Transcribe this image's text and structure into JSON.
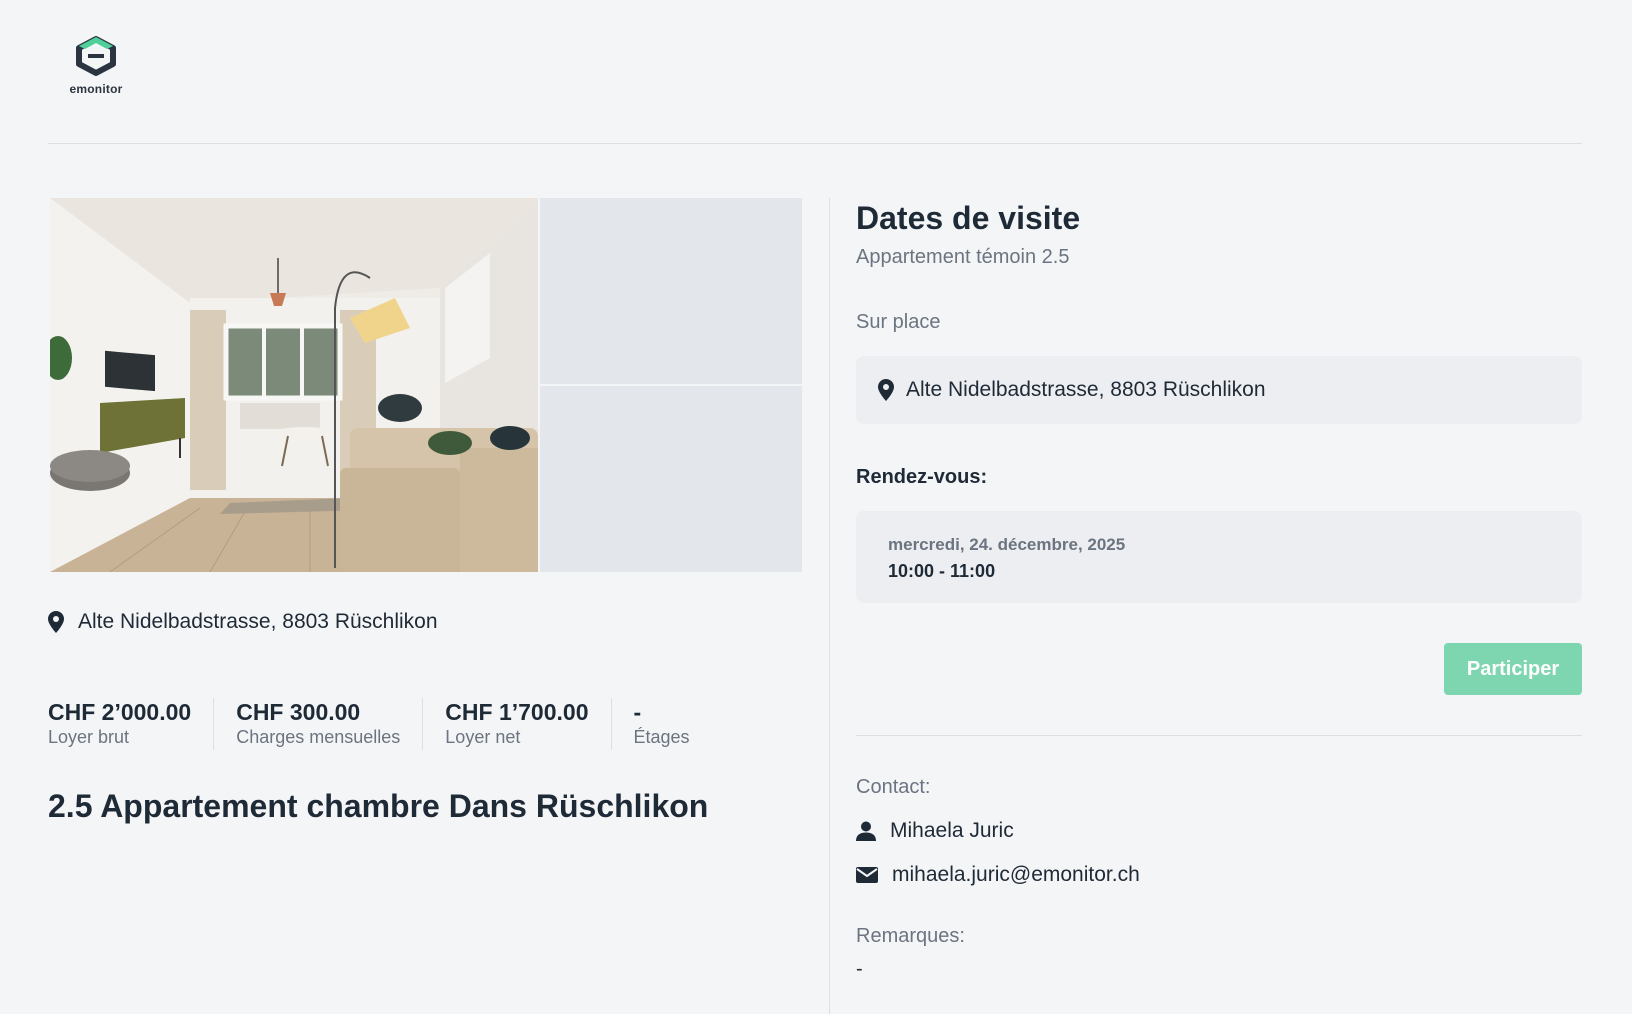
{
  "brand": {
    "name": "emonitor",
    "accent": "#7ed6b1",
    "logo_green": "#4fcf9a",
    "logo_dark": "#2b3440"
  },
  "listing": {
    "address": "Alte Nidelbadstrasse, 8803 Rüschlikon",
    "title": "2.5 Appartement chambre Dans Rüschlikon",
    "stats": [
      {
        "value": "CHF 2’000.00",
        "label": "Loyer brut"
      },
      {
        "value": "CHF 300.00",
        "label": "Charges mensuelles"
      },
      {
        "value": "CHF 1’700.00",
        "label": "Loyer net"
      },
      {
        "value": "-",
        "label": "Étages"
      }
    ]
  },
  "visit": {
    "title": "Dates de visite",
    "subtitle": "Appartement témoin 2.5",
    "location_type": "Sur place",
    "address": "Alte Nidelbadstrasse, 8803 Rüschlikon",
    "appointment_label": "Rendez-vous:",
    "slot": {
      "date": "mercredi, 24. décembre, 2025",
      "time": "10:00 - 11:00"
    },
    "participate_label": "Participer"
  },
  "contact": {
    "label": "Contact:",
    "name": "Mihaela Juric",
    "email": "mihaela.juric@emonitor.ch"
  },
  "remarks": {
    "label": "Remarques:",
    "value": "-"
  }
}
